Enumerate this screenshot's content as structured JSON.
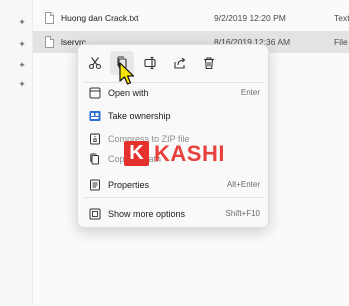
{
  "files": [
    {
      "name": "Huong dan Crack.txt",
      "date": "9/2/2019 12:20 PM",
      "type": "Text"
    },
    {
      "name": "lservrc",
      "date": "8/16/2019 12:36 AM",
      "type": "File"
    }
  ],
  "context_menu": {
    "toolbar": [
      {
        "name": "cut",
        "icon": "scissors-icon"
      },
      {
        "name": "copy",
        "icon": "copy-icon"
      },
      {
        "name": "rename",
        "icon": "rename-icon"
      },
      {
        "name": "share",
        "icon": "share-icon"
      },
      {
        "name": "delete",
        "icon": "trash-icon"
      }
    ],
    "items": [
      {
        "label": "Open with",
        "shortcut": "Enter",
        "icon": "open-with-icon"
      },
      {
        "label": "Take ownership",
        "shortcut": "",
        "icon": "ownership-icon"
      },
      {
        "label": "Compress to ZIP file",
        "shortcut": "",
        "icon": "zip-icon"
      },
      {
        "label": "Copy as path",
        "shortcut": "",
        "icon": "copy-path-icon"
      },
      {
        "label": "Properties",
        "shortcut": "Alt+Enter",
        "icon": "properties-icon"
      },
      {
        "label": "Show more options",
        "shortcut": "Shift+F10",
        "icon": "more-options-icon"
      }
    ]
  },
  "watermark": {
    "badge": "K",
    "text": "KASHI",
    "color": "#e5322d"
  }
}
